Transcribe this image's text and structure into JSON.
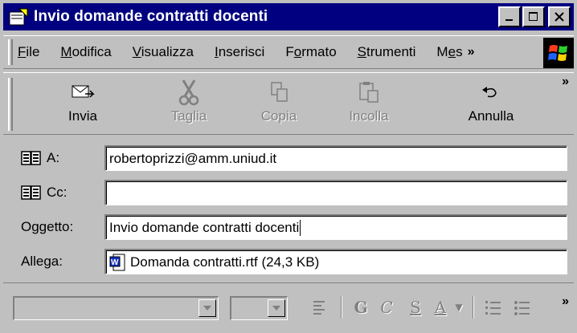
{
  "window": {
    "title": "Invio domande contratti docenti"
  },
  "menu": {
    "items": [
      {
        "pre": "",
        "ul": "F",
        "post": "ile"
      },
      {
        "pre": "",
        "ul": "M",
        "post": "odifica"
      },
      {
        "pre": "",
        "ul": "V",
        "post": "isualizza"
      },
      {
        "pre": "",
        "ul": "I",
        "post": "nserisci"
      },
      {
        "pre": "F",
        "ul": "o",
        "post": "rmato"
      },
      {
        "pre": "",
        "ul": "S",
        "post": "trumenti"
      },
      {
        "pre": "M",
        "ul": "e",
        "post": "s"
      }
    ],
    "overflow": "»"
  },
  "toolbar": {
    "send": "Invia",
    "cut": "Taglia",
    "copy": "Copia",
    "paste": "Incolla",
    "undo": "Annulla",
    "overflow": "»"
  },
  "header": {
    "to_label": "A:",
    "to_value": "robertoprizzi@amm.uniud.it",
    "cc_label": "Cc:",
    "cc_value": "",
    "subject_label": "Oggetto:",
    "subject_value": "Invio domande contratti docenti",
    "attach_label": "Allega:",
    "attach_value": "Domanda contratti.rtf (24,3 KB)"
  },
  "format": {
    "bold": "G",
    "italic": "C",
    "underline": "S",
    "color": "A",
    "overflow": "»"
  }
}
